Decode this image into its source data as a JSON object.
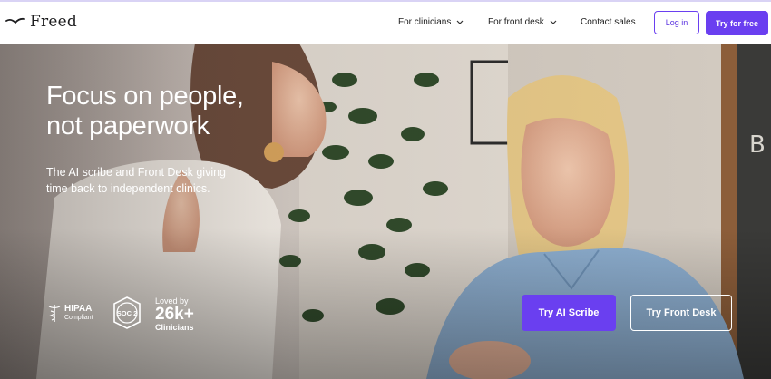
{
  "brand": {
    "name": "Freed",
    "accent": "#6a3ff0"
  },
  "nav": {
    "items": [
      {
        "label": "For clinicians",
        "has_dropdown": true
      },
      {
        "label": "For front desk",
        "has_dropdown": true
      },
      {
        "label": "Contact sales",
        "has_dropdown": false
      }
    ],
    "login_label": "Log in",
    "try_label": "Try for free"
  },
  "hero": {
    "headline": "Focus on people,\nnot paperwork",
    "subhead": "The AI scribe and Front Desk giving time back to independent clinics.",
    "badges": {
      "hipaa_title": "HIPAA",
      "hipaa_sub": "Compliant",
      "soc_label": "SOC 2",
      "loved_prefix": "Loved by",
      "loved_count": "26k+",
      "loved_suffix": "Clinicians"
    },
    "cta_primary": "Try AI Scribe",
    "cta_secondary": "Try Front Desk"
  }
}
